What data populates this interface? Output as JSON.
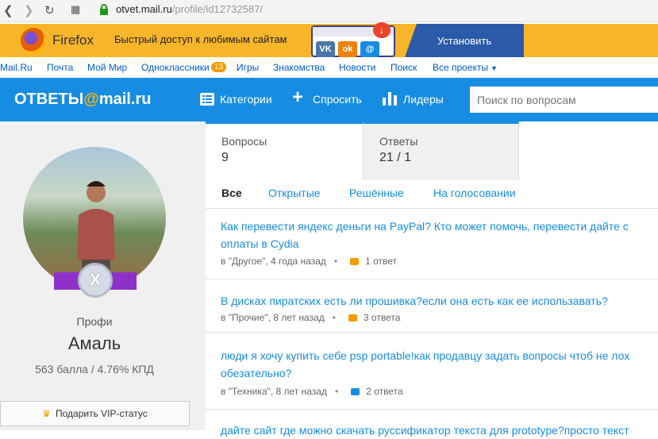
{
  "browser": {
    "url_host": "otvet.mail.ru",
    "url_path": "/profile/id12732587/"
  },
  "firefox_banner": {
    "brand": "Firefox",
    "text": "Быстрый доступ к любимым сайтам",
    "install_label": "Установить"
  },
  "portal_nav": {
    "items": [
      "Mail.Ru",
      "Почта",
      "Мой Мир",
      "Одноклассники",
      "Игры",
      "Знакомства",
      "Новости",
      "Поиск",
      "Все проекты"
    ],
    "ok_badge": "13"
  },
  "header": {
    "logo_left": "ОТВЕТЫ",
    "logo_at": "@",
    "logo_right": "mail.ru",
    "categories_label": "Категории",
    "ask_label": "Спросить",
    "leaders_label": "Лидеры",
    "search_placeholder": "Поиск по вопросам"
  },
  "profile": {
    "rank": "Профи",
    "name": "Амаль",
    "score": "563 балла / 4.76% КПД",
    "vip_label": "Подарить VIP-статус",
    "medal_letter": "X"
  },
  "stats": {
    "questions_label": "Вопросы",
    "questions_value": "9",
    "answers_label": "Ответы",
    "answers_value": "21 / 1"
  },
  "filters": [
    "Все",
    "Открытые",
    "Решённые",
    "На голосовании"
  ],
  "questions": [
    {
      "title_line1": "Как перевести яндекс деньги на PayPal? Кто может помочь, перевести дайте с",
      "title_line2": "оплаты в Cydia",
      "meta": "в \"Другое\", 4 года назад",
      "answers": "1 ответ",
      "bubble_color": "#f59b00"
    },
    {
      "title_line1": "В дисках пиратских есть ли прошивка?если она есть как ее использавать?",
      "title_line2": "",
      "meta": "в \"Прочие\", 8 лет назад",
      "answers": "3 ответа",
      "bubble_color": "#f59b00"
    },
    {
      "title_line1": "люди я хочу купить себе psp portable!как продавцу задать вопросы чтоб не лох",
      "title_line2": "обезательно?",
      "meta": "в \"Техника\", 8 лет назад",
      "answers": "2 ответа",
      "bubble_color": "#168de2"
    },
    {
      "title_line1": "дайте сайт где можно скачать руссификатор текста для prototype?просто текст",
      "title_line2": "",
      "meta": "",
      "answers": "",
      "bubble_color": "#f59b00"
    }
  ]
}
